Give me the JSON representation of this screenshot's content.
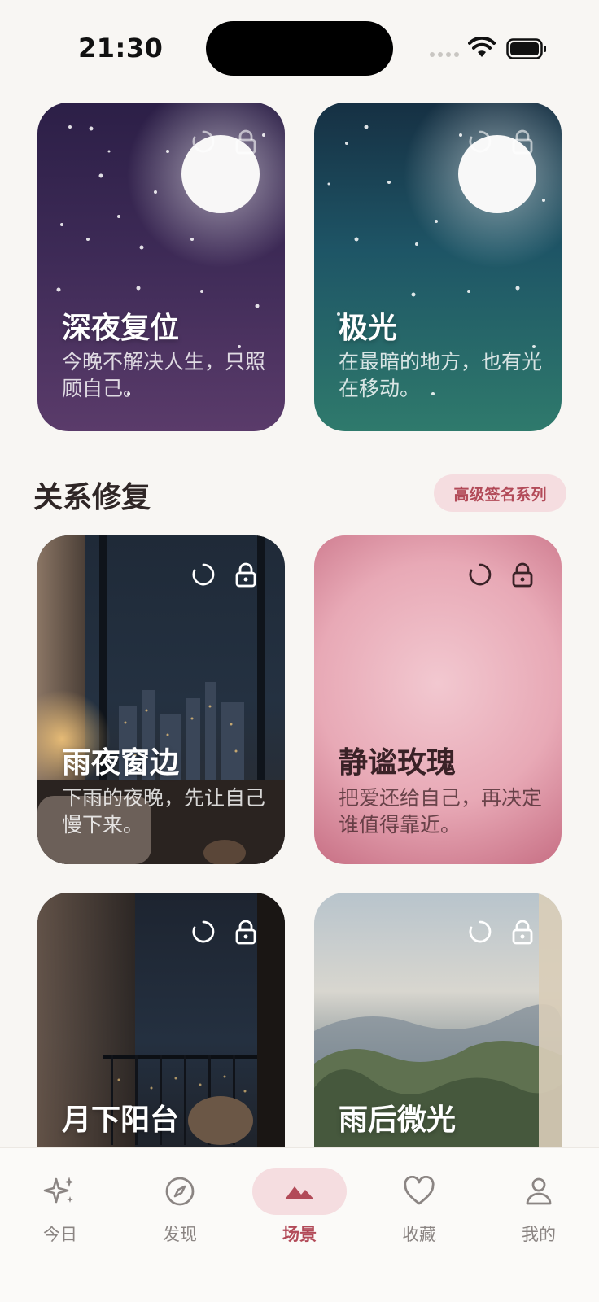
{
  "status": {
    "time": "21:30"
  },
  "top_cards": [
    {
      "title": "深夜复位",
      "subtitle": "今晚不解决人生，只照顾自己。"
    },
    {
      "title": "极光",
      "subtitle": "在最暗的地方，也有光在移动。"
    }
  ],
  "section": {
    "title": "关系修复",
    "badge": "高级签名系列"
  },
  "cards": [
    {
      "title": "雨夜窗边",
      "subtitle": "下雨的夜晚，先让自己慢下来。"
    },
    {
      "title": "静谧玫瑰",
      "subtitle": "把爱还给自己，再决定谁值得靠近。"
    },
    {
      "title": "月下阳台",
      "subtitle": ""
    },
    {
      "title": "雨后微光",
      "subtitle": ""
    }
  ],
  "tabs": [
    {
      "label": "今日",
      "icon": "sparkles-icon"
    },
    {
      "label": "发现",
      "icon": "compass-icon"
    },
    {
      "label": "场景",
      "icon": "mountains-icon",
      "active": true
    },
    {
      "label": "收藏",
      "icon": "heart-icon"
    },
    {
      "label": "我的",
      "icon": "person-icon"
    }
  ],
  "colors": {
    "accent": "#b24a58",
    "accent_bg": "#f5dde0",
    "page_bg": "#f8f6f3"
  }
}
